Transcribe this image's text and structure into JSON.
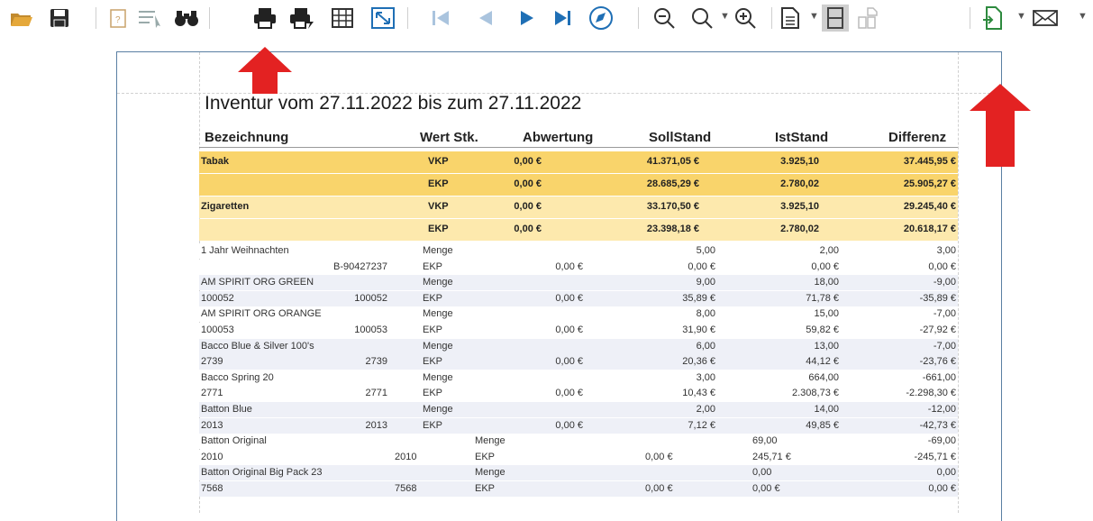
{
  "toolbar": {
    "icons": [
      "open-folder-icon",
      "save-icon",
      "clipboard-icon",
      "list-edit-icon",
      "binoculars-icon",
      "print-icon",
      "quick-print-icon",
      "grid-icon",
      "fit-page-icon",
      "first-page-icon",
      "previous-page-icon",
      "next-page-icon",
      "last-page-icon",
      "navigate-icon",
      "zoom-out-icon",
      "zoom-icon",
      "zoom-in-icon",
      "page-setup-icon",
      "single-page-icon",
      "multi-page-icon",
      "export-icon",
      "email-icon"
    ],
    "accent_color": "#1f6fb5",
    "annotation_color": "#e32222"
  },
  "report": {
    "title": "Inventur vom 27.11.2022 bis zum 27.11.2022",
    "columns": [
      "Bezeichnung",
      "Wert Stk.",
      "Abwertung",
      "SollStand",
      "IstStand",
      "Differenz"
    ],
    "groups": [
      {
        "name": "Tabak",
        "type": "VKP",
        "abwertung": "0,00 €",
        "soll": "41.371,05 €",
        "ist": "3.925,10",
        "diff": "37.445,95 €",
        "color": "#f9d46b"
      },
      {
        "name": "",
        "type": "EKP",
        "abwertung": "0,00 €",
        "soll": "28.685,29 €",
        "ist": "2.780,02",
        "diff": "25.905,27 €",
        "color": "#f9d46b"
      },
      {
        "name": "Zigaretten",
        "type": "VKP",
        "abwertung": "0,00 €",
        "soll": "33.170,50 €",
        "ist": "3.925,10",
        "diff": "29.245,40 €",
        "color": "#fde9ad"
      },
      {
        "name": "",
        "type": "EKP",
        "abwertung": "0,00 €",
        "soll": "23.398,18 €",
        "ist": "2.780,02",
        "diff": "20.618,17 €",
        "color": "#fde9ad"
      }
    ],
    "rows": [
      {
        "a": "1 Jahr Weihnachten",
        "b": "",
        "c": "Menge",
        "d": "",
        "e": "5,00",
        "f": "2,00",
        "g": "3,00"
      },
      {
        "a": "",
        "b": "B-90427237",
        "c": "EKP",
        "d": "0,00 €",
        "e": "0,00 €",
        "f": "0,00 €",
        "g": "0,00 €"
      },
      {
        "a": "AM SPIRIT ORG GREEN",
        "b": "",
        "c": "Menge",
        "d": "",
        "e": "9,00",
        "f": "18,00",
        "g": "-9,00"
      },
      {
        "a": "100052",
        "b": "100052",
        "c": "EKP",
        "d": "0,00 €",
        "e": "35,89 €",
        "f": "71,78 €",
        "g": "-35,89 €"
      },
      {
        "a": "AM SPIRIT ORG ORANGE",
        "b": "",
        "c": "Menge",
        "d": "",
        "e": "8,00",
        "f": "15,00",
        "g": "-7,00"
      },
      {
        "a": "100053",
        "b": "100053",
        "c": "EKP",
        "d": "0,00 €",
        "e": "31,90 €",
        "f": "59,82 €",
        "g": "-27,92 €"
      },
      {
        "a": "Bacco Blue & Silver 100's",
        "b": "",
        "c": "Menge",
        "d": "",
        "e": "6,00",
        "f": "13,00",
        "g": "-7,00"
      },
      {
        "a": "2739",
        "b": "2739",
        "c": "EKP",
        "d": "0,00 €",
        "e": "20,36 €",
        "f": "44,12 €",
        "g": "-23,76 €"
      },
      {
        "a": "Bacco Spring 20",
        "b": "",
        "c": "Menge",
        "d": "",
        "e": "3,00",
        "f": "664,00",
        "g": "-661,00"
      },
      {
        "a": "2771",
        "b": "2771",
        "c": "EKP",
        "d": "0,00 €",
        "e": "10,43 €",
        "f": "2.308,73 €",
        "g": "-2.298,30 €"
      },
      {
        "a": "Batton Blue",
        "b": "",
        "c": "Menge",
        "d": "",
        "e": "2,00",
        "f": "14,00",
        "g": "-12,00"
      },
      {
        "a": "2013",
        "b": "2013",
        "c": "EKP",
        "d": "0,00 €",
        "e": "7,12 €",
        "f": "49,85 €",
        "g": "-42,73 €"
      }
    ],
    "rows_shifted": [
      {
        "a": "Batton Original",
        "b": "",
        "c": "Menge",
        "d": "",
        "e": "69,00",
        "f": "",
        "g": "-69,00"
      },
      {
        "a": "2010",
        "b": "2010",
        "c": "EKP",
        "d": "0,00 €",
        "e": "245,71 €",
        "f": "",
        "g": "-245,71 €"
      },
      {
        "a": "Batton Original Big Pack 23",
        "b": "",
        "c": "Menge",
        "d": "",
        "e": "0,00",
        "f": "",
        "g": "0,00"
      },
      {
        "a": "7568",
        "b": "7568",
        "c": "EKP",
        "d": "0,00 €",
        "e": "0,00 €",
        "f": "",
        "g": "0,00 €"
      }
    ]
  }
}
